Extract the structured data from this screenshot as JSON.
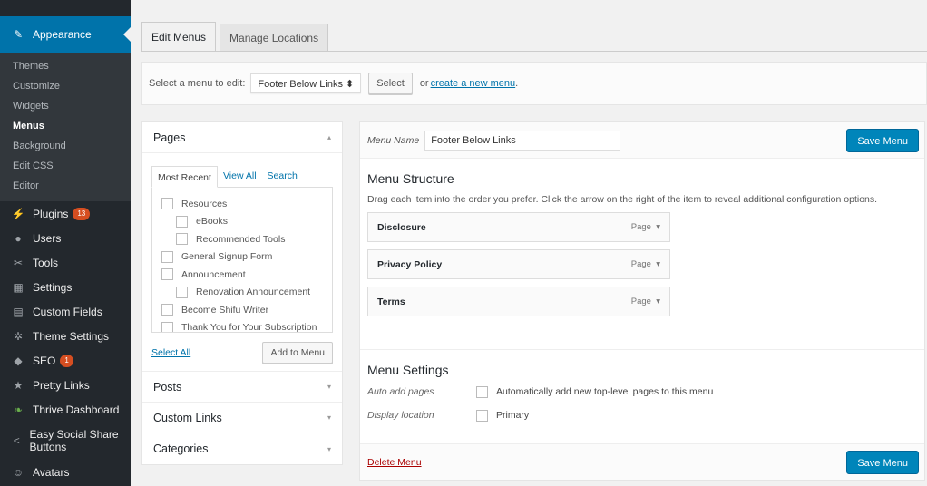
{
  "sidebar": {
    "active": {
      "label": "Appearance",
      "icon": "paintbrush-icon"
    },
    "submenu": [
      "Themes",
      "Customize",
      "Widgets",
      "Menus",
      "Background",
      "Edit CSS",
      "Editor"
    ],
    "current": "Menus",
    "items": [
      {
        "label": "Plugins",
        "icon": "plug-icon",
        "badge": "13"
      },
      {
        "label": "Users",
        "icon": "user-icon"
      },
      {
        "label": "Tools",
        "icon": "wrench-icon"
      },
      {
        "label": "Settings",
        "icon": "sliders-icon"
      },
      {
        "label": "Custom Fields",
        "icon": "grid-icon"
      },
      {
        "label": "Theme Settings",
        "icon": "gear-icon"
      },
      {
        "label": "SEO",
        "icon": "seo-icon",
        "badge": "1"
      },
      {
        "label": "Pretty Links",
        "icon": "star-icon"
      },
      {
        "label": "Thrive Dashboard",
        "icon": "leaf-icon"
      },
      {
        "label": "Easy Social Share Buttons",
        "icon": "share-icon"
      },
      {
        "label": "Avatars",
        "icon": "avatar-icon"
      }
    ]
  },
  "tabs": [
    "Edit Menus",
    "Manage Locations"
  ],
  "select_bar": {
    "label": "Select a menu to edit:",
    "selected": "Footer Below Links",
    "select_button": "Select",
    "or_text": "or",
    "create_link": "create a new menu",
    "end": "."
  },
  "add_items": {
    "pages_title": "Pages",
    "inner_tabs": [
      "Most Recent",
      "View All",
      "Search"
    ],
    "pages": [
      {
        "label": "Resources",
        "level": 0
      },
      {
        "label": "eBooks",
        "level": 1
      },
      {
        "label": "Recommended Tools",
        "level": 1
      },
      {
        "label": "General Signup Form",
        "level": 0
      },
      {
        "label": "Announcement",
        "level": 0
      },
      {
        "label": "Renovation Announcement",
        "level": 1
      },
      {
        "label": "Become Shifu Writer",
        "level": 0
      },
      {
        "label": "Thank You for Your Subscription",
        "level": 0
      }
    ],
    "select_all": "Select All",
    "add_button": "Add to Menu",
    "sections": [
      "Posts",
      "Custom Links",
      "Categories"
    ]
  },
  "menu": {
    "name_label": "Menu Name",
    "name_value": "Footer Below Links",
    "save_label": "Save Menu",
    "structure_title": "Menu Structure",
    "structure_help": "Drag each item into the order you prefer. Click the arrow on the right of the item to reveal additional configuration options.",
    "items": [
      {
        "title": "Disclosure",
        "type": "Page"
      },
      {
        "title": "Privacy Policy",
        "type": "Page"
      },
      {
        "title": "Terms",
        "type": "Page"
      }
    ],
    "settings_title": "Menu Settings",
    "auto_add_label": "Auto add pages",
    "auto_add_text": "Automatically add new top-level pages to this menu",
    "display_label": "Display location",
    "display_text": "Primary",
    "delete_label": "Delete Menu"
  },
  "glyphs": {
    "dropdown": "⬍",
    "expand": "▾",
    "collapse": "▴",
    "item_arrow": "▾"
  },
  "colors": {
    "admin_bar": "#23282d",
    "active": "#0073aa",
    "primary_button": "#0085ba",
    "badge": "#d54e21"
  }
}
